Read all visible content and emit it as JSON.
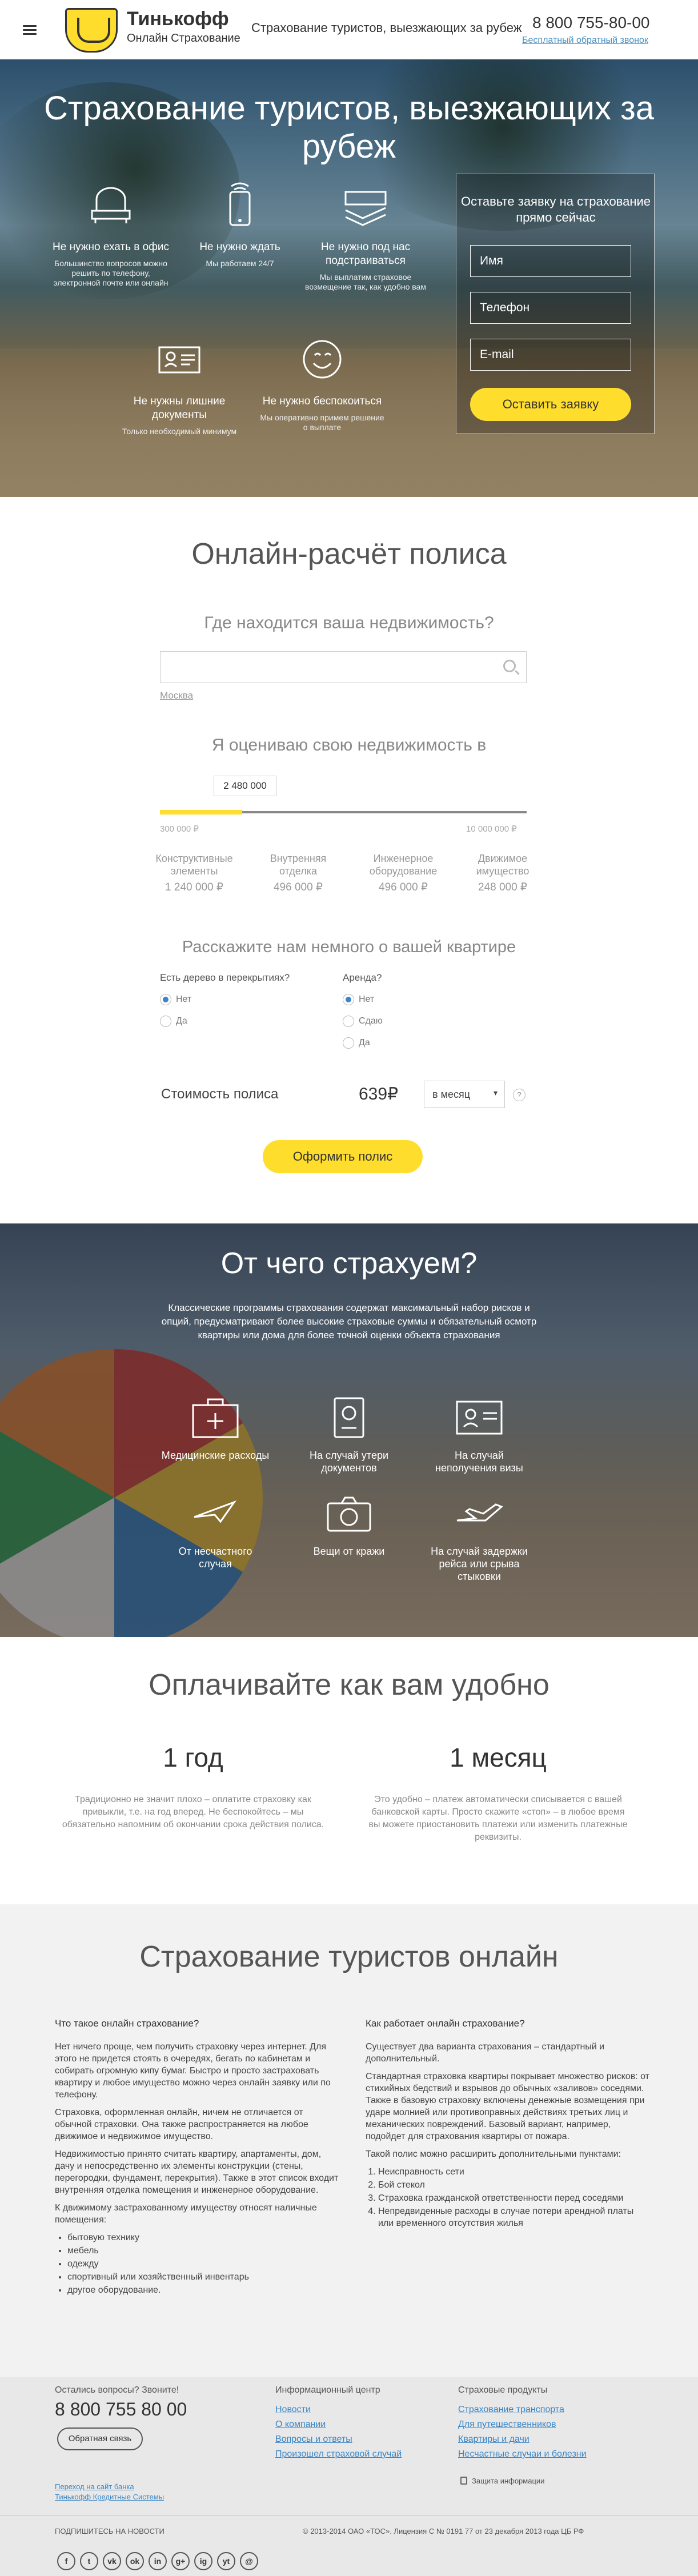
{
  "header": {
    "logo_title": "Тинькофф",
    "logo_subtitle": "Онлайн Страхование",
    "tagline": "Страхование туристов, выезжающих за рубеж",
    "phone": "8 800 755-80-00",
    "callback": "Бесплатный обратный звонок"
  },
  "hero": {
    "title": "Страхование туристов, выезжающих за рубеж",
    "features": [
      {
        "title": "Не нужно ехать в офис",
        "desc": "Большинство вопросов можно решить по телефону, электронной почте или онлайн",
        "icon": "armchair-icon"
      },
      {
        "title": "Не нужно ждать",
        "desc": "Мы работаем 24/7",
        "icon": "phone-icon"
      },
      {
        "title": "Не нужно под нас подстраиваться",
        "desc": "Мы выплатим страховое возмещение так, как удобно вам",
        "icon": "money-icon"
      },
      {
        "title": "Не нужны лишние документы",
        "desc": "Только необходимый минимум",
        "icon": "id-card-icon"
      },
      {
        "title": "Не нужно беспокоиться",
        "desc": "Мы оперативно примем решение о выплате",
        "icon": "smile-icon"
      }
    ],
    "form": {
      "title": "Оставьте заявку на страхование прямо сейчас",
      "name_placeholder": "Имя",
      "phone_placeholder": "Телефон",
      "email_placeholder": "E-mail",
      "submit": "Оставить заявку"
    }
  },
  "calc": {
    "title": "Онлайн-расчёт полиса",
    "location_question": "Где находится ваша недвижимость?",
    "location_hint": "Москва",
    "value_question": "Я оцениваю свою недвижимость в",
    "slider_value": "2 480 000",
    "slider_fraction": 0.225,
    "slider_min": "300 000 ₽",
    "slider_max": "10 000 000 ₽",
    "categories": [
      {
        "name": "Конструктивные элементы",
        "value": "1 240 000 ₽"
      },
      {
        "name": "Внутренняя отделка",
        "value": "496 000 ₽"
      },
      {
        "name": "Инженерное оборудование",
        "value": "496 000 ₽"
      },
      {
        "name": "Движимое имущество",
        "value": "248 000 ₽"
      }
    ],
    "apartment_title": "Расскажите нам немного о вашей квартире",
    "q1": "Есть дерево в перекрытиях?",
    "q1_opts": [
      "Нет",
      "Да"
    ],
    "q2": "Аренда?",
    "q2_opts": [
      "Нет",
      "Сдаю",
      "Да"
    ],
    "cost_label": "Стоимость полиса",
    "cost_value": "639₽",
    "period_selected": "в месяц",
    "order_button": "Оформить полис"
  },
  "risks": {
    "title": "От чего страхуем?",
    "desc": "Классические программы страхования содержат максимальный набор рисков и опций, предусматривают более высокие страховые суммы и обязательный осмотр квартиры или дома для более точной оценки объекта страхования",
    "items": [
      {
        "label": "Медицинские расходы",
        "icon": "medkit-icon"
      },
      {
        "label": "На случай утери документов",
        "icon": "passport-icon"
      },
      {
        "label": "На случай неполучения визы",
        "icon": "visa-icon"
      },
      {
        "label": "От несчастного случая",
        "icon": "plane-icon"
      },
      {
        "label": "Вещи от кражи",
        "icon": "camera-icon"
      },
      {
        "label": "На случай задержки рейса или срыва стыковки",
        "icon": "airplane-delay-icon"
      }
    ]
  },
  "payment": {
    "title": "Оплачивайте как вам удобно",
    "plans": [
      {
        "name": "1 год",
        "desc": "Традиционно не значит плохо – оплатите страховку как привыкли, т.е. на год вперед. Не беспокойтесь – мы обязательно напомним об окончании срока действия полиса."
      },
      {
        "name": "1 месяц",
        "desc": "Это удобно – платеж автоматически списывается с вашей банковской карты. Просто скажите «стоп» – в любое время вы можете приостановить платежи или изменить платежные реквизиты."
      }
    ]
  },
  "info": {
    "title": "Страхование туристов онлайн",
    "left_heading": "Что такое онлайн страхование?",
    "left_p1": "Нет ничего проще, чем получить страховку через интернет. Для этого не придется стоять в очередях, бегать по кабинетам и собирать огромную кипу бумаг. Быстро и просто застраховать квартиру и любое имущество можно через онлайн заявку или по телефону.",
    "left_p2": "Страховка, оформленная онлайн, ничем не отличается от обычной страховки. Она также распространяется на любое движимое и недвижимое имущество.",
    "left_p3": "Недвижимостью принято считать квартиру, апартаменты, дом, дачу и непосредственно их элементы конструкции (стены, перегородки, фундамент, перекрытия). Также в этот список входит внутренняя отделка помещения и инженерное оборудование.",
    "left_p4": "К движимому застрахованному имуществу относят наличные помещения:",
    "left_list": [
      "бытовую технику",
      "мебель",
      "одежду",
      "спортивный или хозяйственный инвентарь",
      "другое оборудование."
    ],
    "right_heading": "Как работает онлайн страхование?",
    "right_p1": "Существует два варианта страхования – стандартный и дополнительный.",
    "right_p2": "Стандартная страховка квартиры покрывает множество рисков: от стихийных бедствий и взрывов до обычных «заливов» соседями. Также в базовую страховку включены денежные возмещения при ударе молнией или противоправных действиях третьих лиц и механических повреждений. Базовый вариант, например, подойдет для страхования квартиры от пожара.",
    "right_p3": "Такой полис можно расширить дополнительными пунктами:",
    "right_list": [
      "Неисправность сети",
      "Бой стекол",
      "Страховка гражданской ответственности перед соседями",
      "Непредвиденные расходы в случае потери арендной платы или временного отсутствия жилья"
    ]
  },
  "footer": {
    "questions": "Остались вопросы? Звоните!",
    "phone": "8 800 755 80 00",
    "feedback": "Обратная связь",
    "bank_link": "Переход на сайт банка",
    "systems_link": "Тинькофф Кредитные Системы",
    "info_heading": "Информационный центр",
    "info_links": [
      "Новости",
      "О компании",
      "Вопросы и ответы",
      "Произошел страховой случай"
    ],
    "products_heading": "Страховые продукты",
    "product_links": [
      "Страхование транспорта",
      "Для путешественников",
      "Квартиры и дачи",
      "Несчастные случаи и болезни"
    ],
    "security": "Защита информации",
    "subscribe": "ПОДПИШИТЕСЬ НА НОВОСТИ",
    "copyright": "© 2013-2014 ОАО «ТОС». Лицензия С № 0191 77 от 23 декабря 2013 года ЦБ РФ",
    "socials": [
      "f",
      "t",
      "vk",
      "ok",
      "in",
      "g+",
      "ig",
      "yt",
      "@"
    ]
  }
}
